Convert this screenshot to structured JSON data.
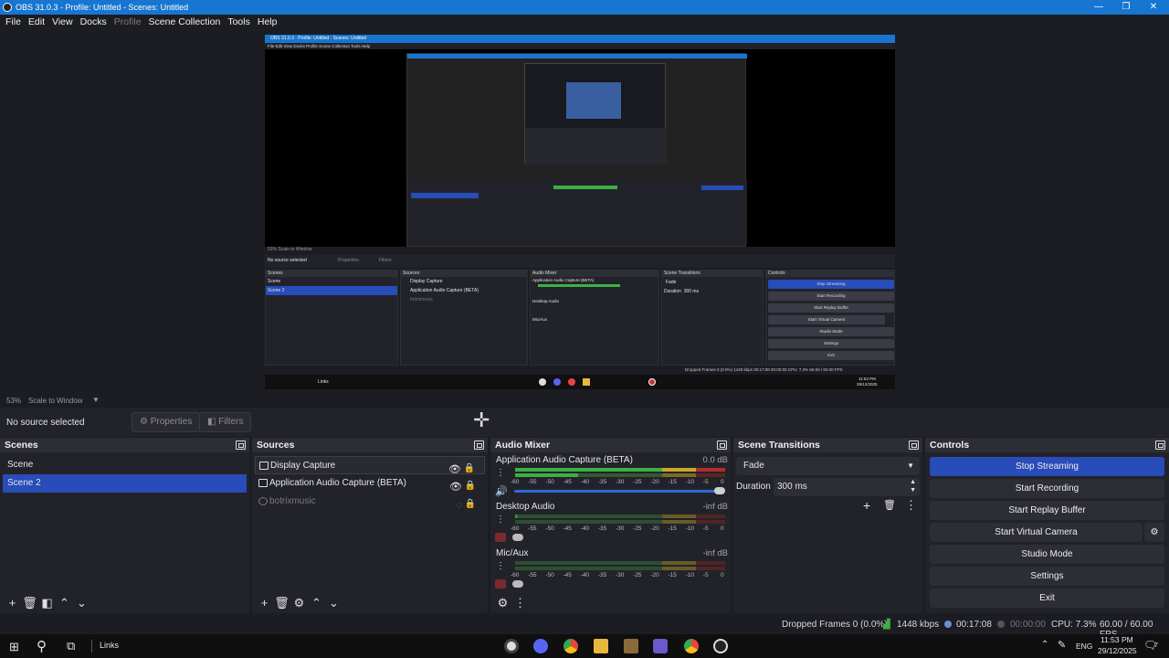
{
  "window": {
    "title": "OBS 31.0.3 - Profile: Untitled - Scenes: Untitled",
    "minimize": "—",
    "maximize": "❐",
    "close": "✕"
  },
  "menu": [
    "File",
    "Edit",
    "View",
    "Docks",
    "Profile",
    "Scene Collection",
    "Tools",
    "Help"
  ],
  "preview": {
    "zoom": "53%",
    "scale": "Scale to Window",
    "inner_title": "OBS 31.0.3 - Profile: Untitled - Scenes: Untitled",
    "inner_menu": "File  Edit  View  Docks  Profile  Scene Collection  Tools  Help",
    "inner_zoom": "53%   Scale to Window",
    "inner_no_source": "No source selected",
    "inner_properties": "Properties",
    "inner_filters": "Filters",
    "inner_scenes_title": "Scenes",
    "inner_sources_title": "Sources",
    "inner_mixer_title": "Audio Mixer",
    "inner_transitions_title": "Scene Transitions",
    "inner_controls_title": "Controls",
    "inner_scene1": "Scene",
    "inner_scene2": "Scene 2",
    "inner_src1": "Display Capture",
    "inner_src2": "Application Audio Capture (BETA)",
    "inner_src3": "botrixmusic",
    "inner_mix1": "Application Audio Capture (BETA)",
    "inner_mix1_db": "0.0 dB",
    "inner_mix2": "Desktop Audio",
    "inner_mix2_db": "-inf dB",
    "inner_mix3": "Mic/Aux",
    "inner_mix3_db": "-inf dB",
    "inner_fade": "Fade",
    "inner_duration": "Duration",
    "inner_duration_val": "300 ms",
    "inner_ctrls": [
      "Stop Streaming",
      "Start Recording",
      "Start Replay Buffer",
      "Start Virtual Camera",
      "Studio Mode",
      "Settings",
      "Exit"
    ],
    "inner_status": "Dropped Frames 0 (0.0%)    1448 kbps    00:17:08    00:00:00    CPU: 7.3%    60.00 / 60.00 FPS",
    "inner_taskbar_links": "Links",
    "inner_clock": "11:53 PM",
    "inner_date": "29/12/2025"
  },
  "context": {
    "no_source": "No source selected",
    "properties": "Properties",
    "filters": "Filters"
  },
  "scenes": {
    "title": "Scenes",
    "items": [
      "Scene",
      "Scene 2"
    ],
    "selected_index": 1
  },
  "sources": {
    "title": "Sources",
    "items": [
      "Display Capture",
      "Application Audio Capture (BETA)",
      "botrixmusic"
    ]
  },
  "mixer": {
    "title": "Audio Mixer",
    "channels": [
      {
        "name": "Application Audio Capture (BETA)",
        "db": "0.0 dB"
      },
      {
        "name": "Desktop Audio",
        "db": "-inf dB"
      },
      {
        "name": "Mic/Aux",
        "db": "-inf dB"
      }
    ],
    "ticks": [
      "-60",
      "-55",
      "-50",
      "-45",
      "-40",
      "-35",
      "-30",
      "-25",
      "-20",
      "-15",
      "-10",
      "-5",
      "0"
    ]
  },
  "transitions": {
    "title": "Scene Transitions",
    "selected": "Fade",
    "duration_label": "Duration",
    "duration_value": "300 ms"
  },
  "controls": {
    "title": "Controls",
    "buttons": [
      "Stop Streaming",
      "Start Recording",
      "Start Replay Buffer",
      "Start Virtual Camera",
      "Studio Mode",
      "Settings",
      "Exit"
    ],
    "accent": "#284cb8"
  },
  "status": {
    "dropped": "Dropped Frames 0 (0.0%)",
    "bitrate": "1448 kbps",
    "stream_time": "00:17:08",
    "rec_time": "00:00:00",
    "cpu": "CPU: 7.3%",
    "fps": "60.00 / 60.00 FPS"
  },
  "taskbar": {
    "links": "Links",
    "lang": "ENG",
    "time": "11:53 PM",
    "date": "29/12/2025",
    "notifications": "7"
  }
}
